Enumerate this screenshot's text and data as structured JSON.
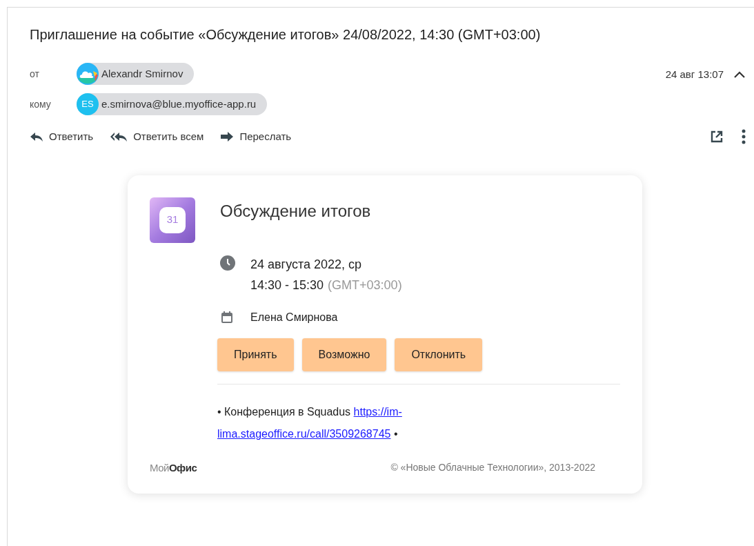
{
  "subject": "Приглашение на событие «Обсуждение итогов» 24/08/2022, 14:30 (GMT+03:00)",
  "from": {
    "label": "от",
    "name": "Alexandr Smirnov"
  },
  "to": {
    "label": "кому",
    "initials": "ES",
    "address": "e.smirnova@blue.myoffice-app.ru"
  },
  "date": "24 авг 13:07",
  "expanded": true,
  "actions": [
    {
      "kind": "reply",
      "label": "Ответить"
    },
    {
      "kind": "reply_all",
      "label": "Ответить всем"
    },
    {
      "kind": "forward",
      "label": "Переслать"
    }
  ],
  "invite": {
    "title": "Обсуждение итогов",
    "calendar_day": "31",
    "date": "24 августа 2022, ср",
    "time": "14:30 - 15:30",
    "timezone": "(GMT+03:00)",
    "organizer": "Елена Смирнова",
    "buttons": [
      "Принять",
      "Возможно",
      "Отклонить"
    ],
    "description": {
      "before": "• Конференция в Squadus",
      "link_lines": [
        "https://im-",
        "lima.stageoffice.ru/call/3509268745"
      ],
      "after": "•"
    },
    "logo": "Мой**Офис**",
    "copyright": "© «Новые Облачные Технологии», 2013-2022"
  }
}
